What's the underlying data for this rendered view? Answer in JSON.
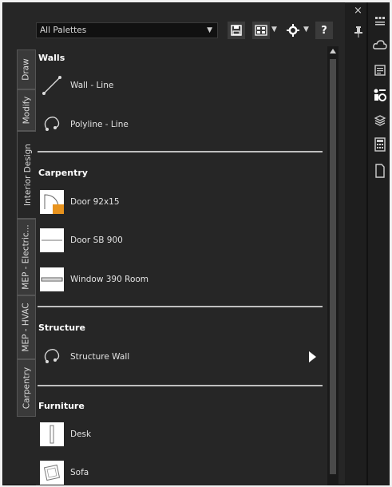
{
  "palette_select": {
    "value": "All Palettes"
  },
  "toolbar": {
    "help_label": "?"
  },
  "close_label": "×",
  "tabs": [
    {
      "label": "Draw"
    },
    {
      "label": "Modify"
    },
    {
      "label": "Interior Design"
    },
    {
      "label": "MEP - Electric..."
    },
    {
      "label": "MEP - HVAC"
    },
    {
      "label": "Carpentry"
    }
  ],
  "groups": {
    "walls": {
      "title": "Walls",
      "items": [
        {
          "label": "Wall - Line",
          "icon": "wall-line-icon"
        },
        {
          "label": "Polyline - Line",
          "icon": "polyline-icon"
        }
      ]
    },
    "carpentry": {
      "title": "Carpentry",
      "items": [
        {
          "label": "Door 92x15",
          "icon": "door-thumbnail"
        },
        {
          "label": "Door SB 900",
          "icon": "door-sb-thumbnail"
        },
        {
          "label": "Window 390 Room",
          "icon": "window-thumbnail"
        }
      ]
    },
    "structure": {
      "title": "Structure",
      "items": [
        {
          "label": "Structure Wall",
          "icon": "structure-wall-icon"
        }
      ]
    },
    "furniture": {
      "title": "Furniture",
      "items": [
        {
          "label": "Desk",
          "icon": "desk-thumbnail"
        },
        {
          "label": "Sofa",
          "icon": "sofa-thumbnail"
        }
      ]
    }
  },
  "colors": {
    "panel_bg": "#262626",
    "tab_bg": "#3a3a3a",
    "divider": "#bfbfbf"
  }
}
